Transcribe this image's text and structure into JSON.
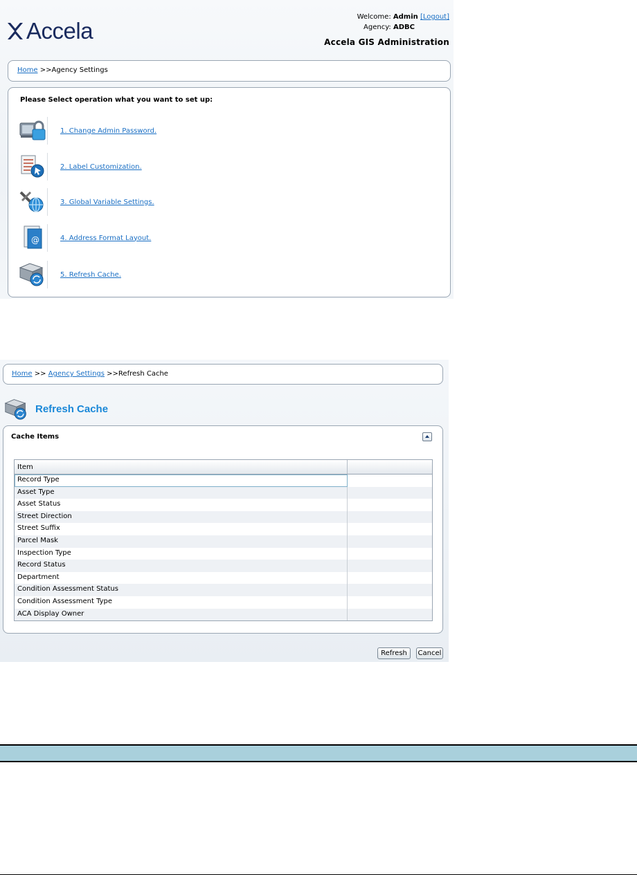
{
  "admin_page": {
    "logo_text": "Accela",
    "welcome_label": "Welcome:",
    "user": "Admin",
    "logout_link": "[Logout]",
    "agency_label": "Agency:",
    "agency": "ADBC",
    "app_title": "Accela GIS Administration",
    "breadcrumb": {
      "home": "Home",
      "separator": ">>",
      "current": "Agency Settings"
    },
    "prompt": "Please Select operation what you want to set up:",
    "operations": [
      {
        "label": "1.  Change Admin Password.",
        "icon": "lock-icon"
      },
      {
        "label": "2.  Label Customization.",
        "icon": "label-customization-icon"
      },
      {
        "label": "3.  Global Variable Settings.",
        "icon": "global-settings-icon"
      },
      {
        "label": "4.  Address Format Layout.",
        "icon": "address-format-icon"
      },
      {
        "label": "5.  Refresh Cache.",
        "icon": "refresh-cache-icon"
      }
    ]
  },
  "refresh_cache_page": {
    "breadcrumb": {
      "home": "Home",
      "separator1": ">>",
      "middle": "Agency Settings",
      "separator2": ">>",
      "current": "Refresh Cache"
    },
    "title": "Refresh Cache",
    "panel_title": "Cache Items",
    "grid": {
      "column_header": "Item",
      "rows": [
        "Record Type",
        "Asset Type",
        "Asset Status",
        "Street Direction",
        "Street Suffix",
        "Parcel Mask",
        "Inspection Type",
        "Record Status",
        "Department",
        "Condition Assessment Status",
        "Condition Assessment Type",
        "ACA Display Owner"
      ]
    },
    "refresh_button": "Refresh",
    "cancel_button": "Cancel"
  },
  "colors": {
    "link": "#1a6fc4",
    "title_blue": "#1a88d8",
    "table_header": "#a9d0dc",
    "logo_navy": "#1a2b5e"
  }
}
